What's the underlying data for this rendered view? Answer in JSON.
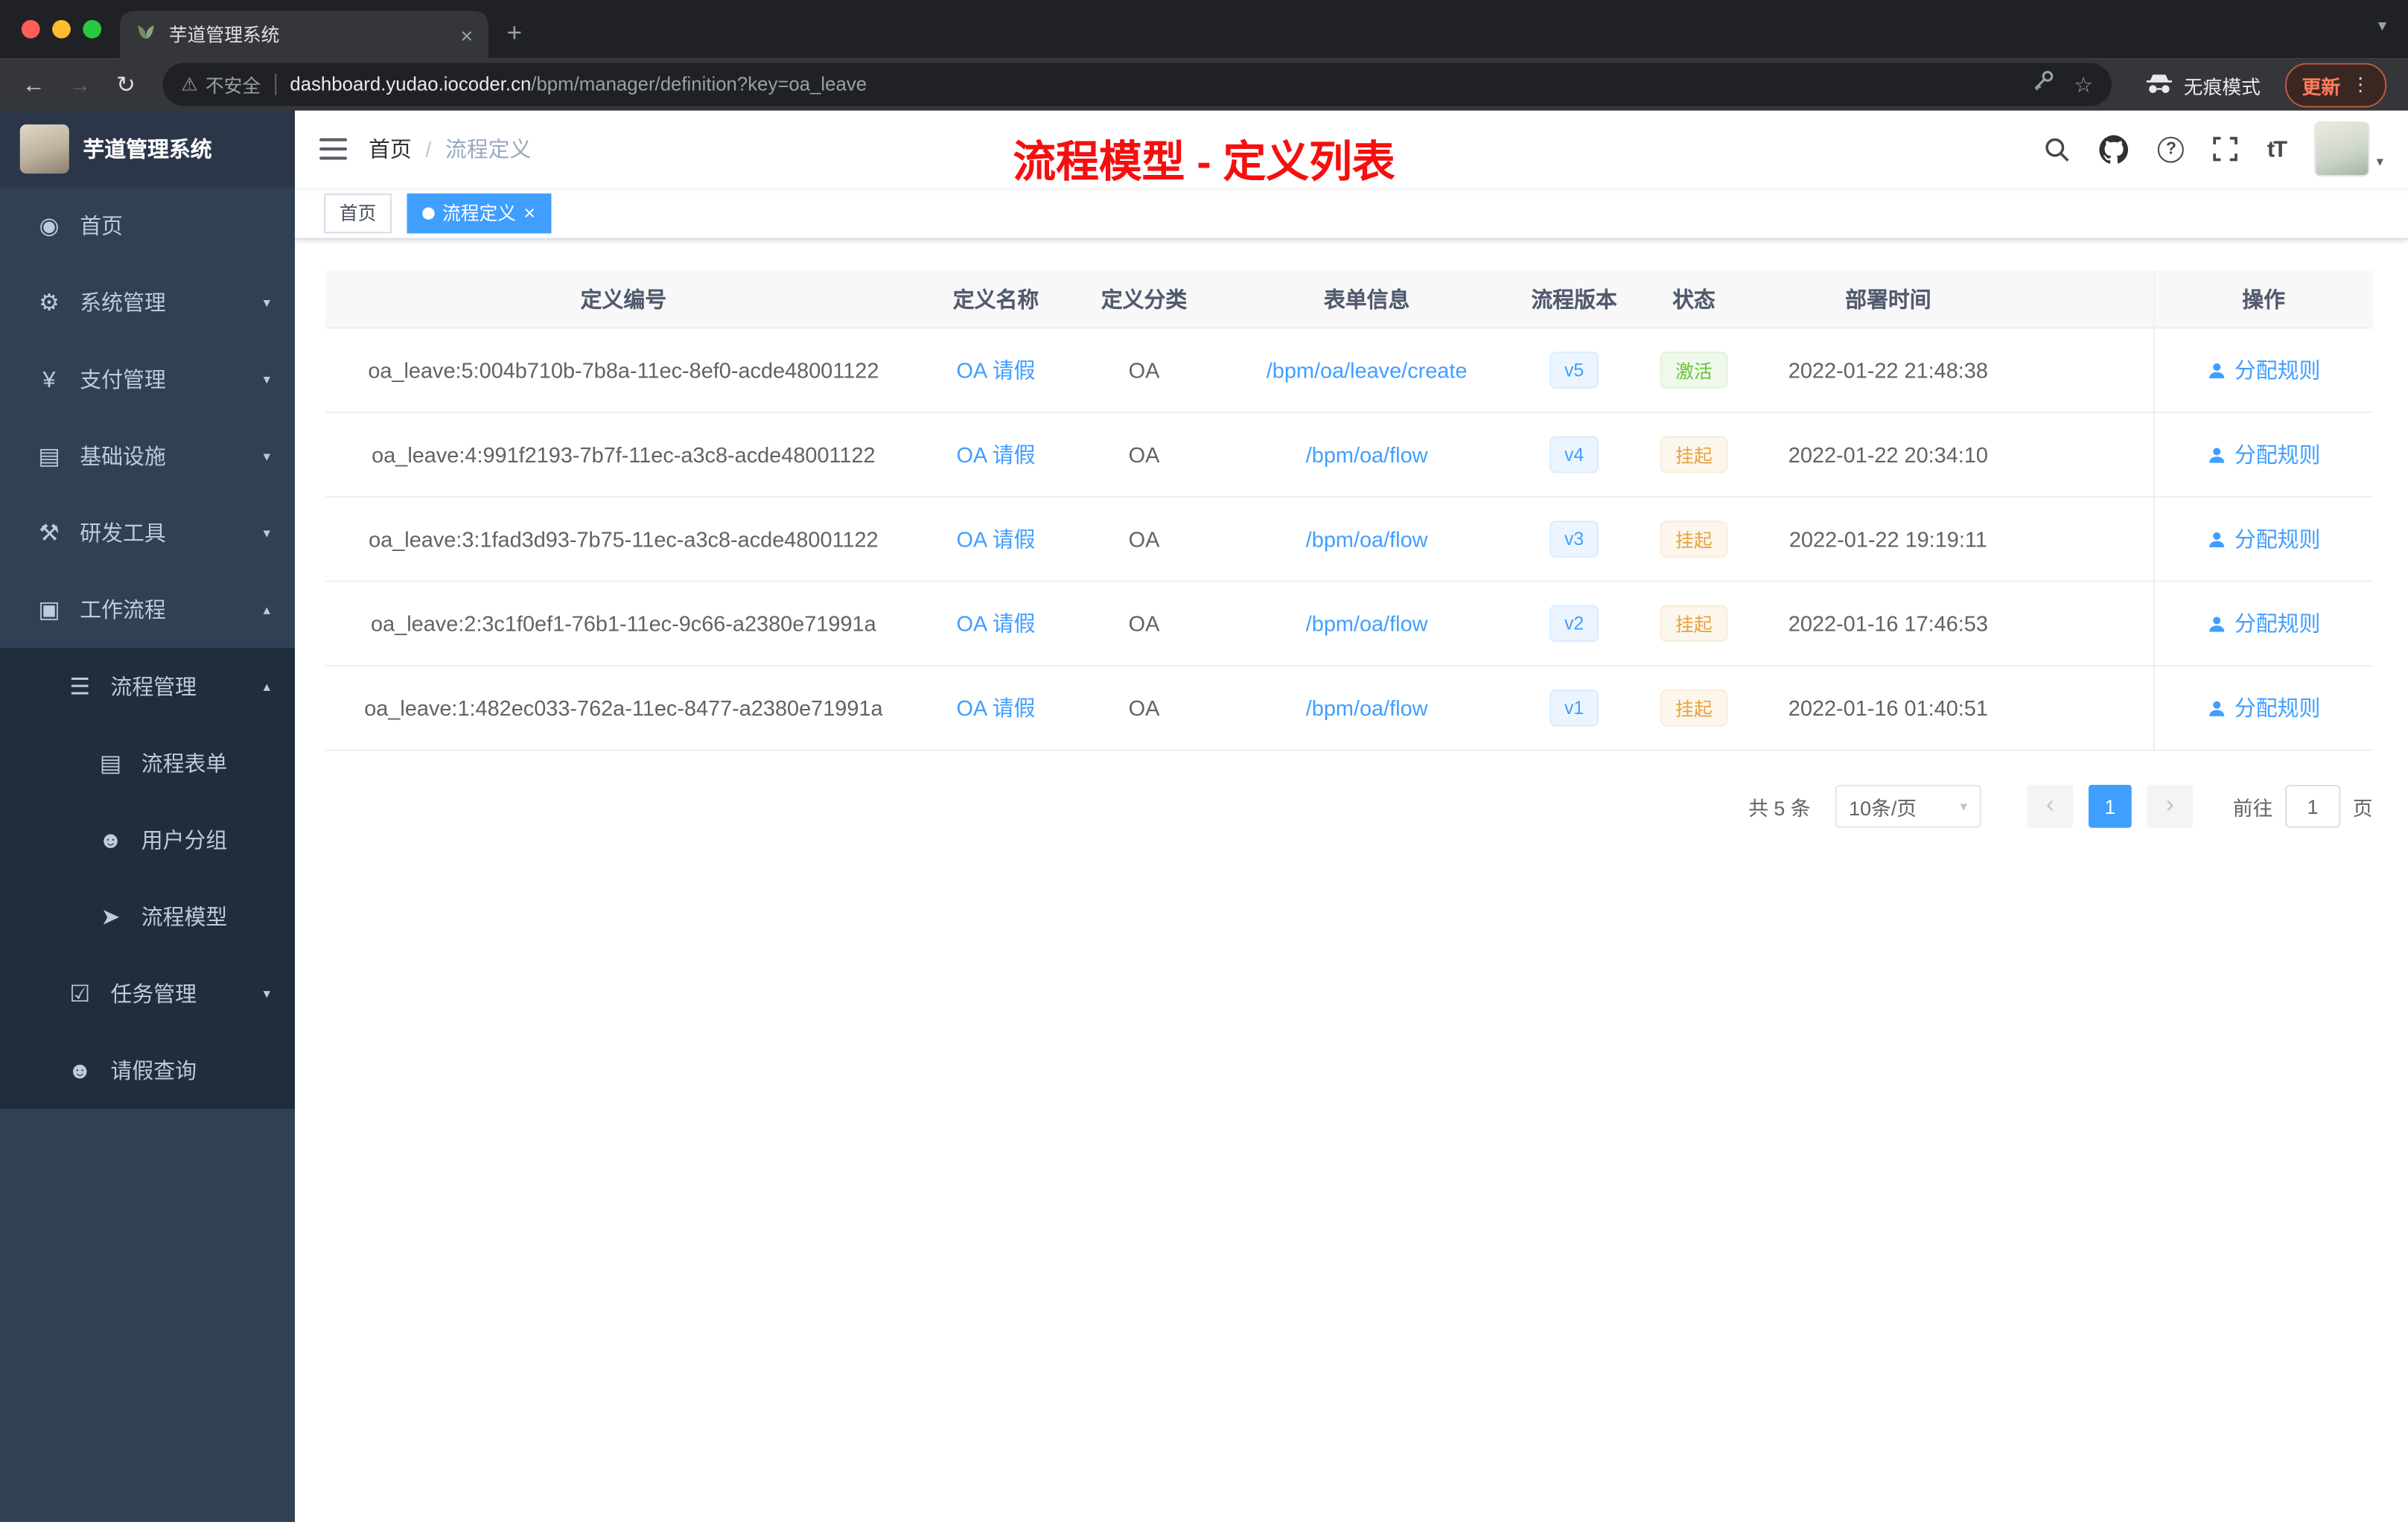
{
  "browser": {
    "tab": {
      "title": "芋道管理系统",
      "close": "×",
      "new_tab": "+"
    },
    "toolbar": {
      "security_label": "不安全",
      "url_domain": "dashboard.yudao.iocoder.cn",
      "url_path": "/bpm/manager/definition?key=oa_leave",
      "incognito_label": "无痕模式",
      "update_label": "更新",
      "menu_dots": "⋮",
      "star_glyph": "☆",
      "warn_glyph": "⚠",
      "back_glyph": "←",
      "forward_glyph": "→",
      "reload_glyph": "↻",
      "strip_chevron": "▾"
    }
  },
  "sidebar": {
    "logo_title": "芋道管理系统",
    "items": [
      {
        "label": "首页",
        "glyph": "◉",
        "arrow": "",
        "level": 1
      },
      {
        "label": "系统管理",
        "glyph": "⚙",
        "arrow": "▾",
        "level": 1
      },
      {
        "label": "支付管理",
        "glyph": "¥",
        "arrow": "▾",
        "level": 1
      },
      {
        "label": "基础设施",
        "glyph": "▤",
        "arrow": "▾",
        "level": 1
      },
      {
        "label": "研发工具",
        "glyph": "⚒",
        "arrow": "▾",
        "level": 1
      },
      {
        "label": "工作流程",
        "glyph": "▣",
        "arrow": "▴",
        "level": 1
      },
      {
        "label": "流程管理",
        "glyph": "☰",
        "arrow": "▴",
        "level": 2
      },
      {
        "label": "流程表单",
        "glyph": "▤",
        "arrow": "",
        "level": 3
      },
      {
        "label": "用户分组",
        "glyph": "☻",
        "arrow": "",
        "level": 3
      },
      {
        "label": "流程模型",
        "glyph": "➤",
        "arrow": "",
        "level": 3
      },
      {
        "label": "任务管理",
        "glyph": "☑",
        "arrow": "▾",
        "level": 2
      },
      {
        "label": "请假查询",
        "glyph": "☻",
        "arrow": "",
        "level": 2
      }
    ]
  },
  "header": {
    "breadcrumb_home": "首页",
    "breadcrumb_sep": "/",
    "breadcrumb_current": "流程定义",
    "overlay_title": "流程模型 - 定义列表",
    "question_glyph": "?",
    "fontsize_label": "tT",
    "avatar_caret": "▾"
  },
  "tags": {
    "home": "首页",
    "active": "流程定义",
    "close": "×"
  },
  "table": {
    "columns": [
      "定义编号",
      "定义名称",
      "定义分类",
      "表单信息",
      "流程版本",
      "状态",
      "部署时间",
      "操作"
    ],
    "rows": [
      {
        "id": "oa_leave:5:004b710b-7b8a-11ec-8ef0-acde48001122",
        "name": "OA 请假",
        "category": "OA",
        "form": "/bpm/oa/leave/create",
        "version": "v5",
        "status": "激活",
        "status_type": "success",
        "time": "2022-01-22 21:48:38",
        "action": "分配规则"
      },
      {
        "id": "oa_leave:4:991f2193-7b7f-11ec-a3c8-acde48001122",
        "name": "OA 请假",
        "category": "OA",
        "form": "/bpm/oa/flow",
        "version": "v4",
        "status": "挂起",
        "status_type": "warning",
        "time": "2022-01-22 20:34:10",
        "action": "分配规则"
      },
      {
        "id": "oa_leave:3:1fad3d93-7b75-11ec-a3c8-acde48001122",
        "name": "OA 请假",
        "category": "OA",
        "form": "/bpm/oa/flow",
        "version": "v3",
        "status": "挂起",
        "status_type": "warning",
        "time": "2022-01-22 19:19:11",
        "action": "分配规则"
      },
      {
        "id": "oa_leave:2:3c1f0ef1-76b1-11ec-9c66-a2380e71991a",
        "name": "OA 请假",
        "category": "OA",
        "form": "/bpm/oa/flow",
        "version": "v2",
        "status": "挂起",
        "status_type": "warning",
        "time": "2022-01-16 17:46:53",
        "action": "分配规则"
      },
      {
        "id": "oa_leave:1:482ec033-762a-11ec-8477-a2380e71991a",
        "name": "OA 请假",
        "category": "OA",
        "form": "/bpm/oa/flow",
        "version": "v1",
        "status": "挂起",
        "status_type": "warning",
        "time": "2022-01-16 01:40:51",
        "action": "分配规则"
      }
    ]
  },
  "pagination": {
    "total": "共 5 条",
    "page_size": "10条/页",
    "size_caret": "▾",
    "prev": "‹",
    "current": "1",
    "next": "›",
    "goto_label": "前往",
    "goto_value": "1",
    "page_unit": "页"
  },
  "colors": {
    "primary": "#409eff",
    "title_red": "#f50f0f",
    "success": "#67c23a",
    "warning": "#e6a23c",
    "sidebar_bg": "#304156",
    "submenu_bg": "#1f2d3d"
  }
}
